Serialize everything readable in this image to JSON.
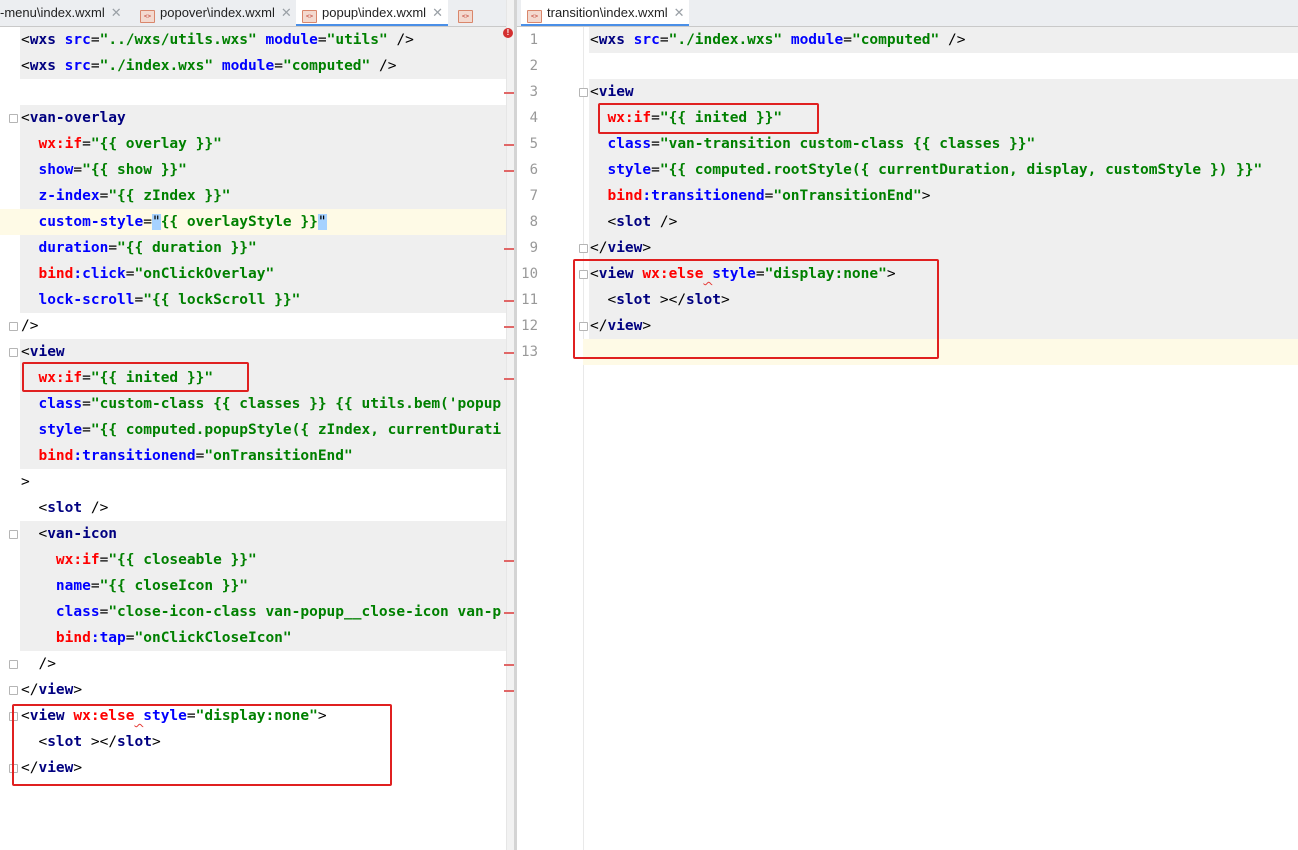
{
  "left_editor": {
    "tabs": [
      {
        "label": "-menu\\index.wxml",
        "active": false
      },
      {
        "label": "popover\\index.wxml",
        "active": false
      },
      {
        "label": "popup\\index.wxml",
        "active": true
      }
    ],
    "lines": [
      {
        "segs": [
          {
            "t": "p",
            "v": "<"
          },
          {
            "t": "t",
            "v": "wxs"
          },
          {
            "t": "p",
            "v": " "
          },
          {
            "t": "a",
            "v": "src"
          },
          {
            "t": "p",
            "v": "="
          },
          {
            "t": "s",
            "v": "\"../wxs/utils.wxs\""
          },
          {
            "t": "p",
            "v": " "
          },
          {
            "t": "a",
            "v": "module"
          },
          {
            "t": "p",
            "v": "="
          },
          {
            "t": "s",
            "v": "\"utils\""
          },
          {
            "t": "p",
            "v": " />"
          }
        ]
      },
      {
        "segs": [
          {
            "t": "p",
            "v": "<"
          },
          {
            "t": "t",
            "v": "wxs"
          },
          {
            "t": "p",
            "v": " "
          },
          {
            "t": "a",
            "v": "src"
          },
          {
            "t": "p",
            "v": "="
          },
          {
            "t": "s",
            "v": "\"./index.wxs\""
          },
          {
            "t": "p",
            "v": " "
          },
          {
            "t": "a",
            "v": "module"
          },
          {
            "t": "p",
            "v": "="
          },
          {
            "t": "s",
            "v": "\"computed\""
          },
          {
            "t": "p",
            "v": " />"
          }
        ]
      },
      {
        "segs": []
      },
      {
        "segs": [
          {
            "t": "p",
            "v": "<"
          },
          {
            "t": "t",
            "v": "van-overlay"
          }
        ]
      },
      {
        "segs": [
          {
            "t": "p",
            "v": "  "
          },
          {
            "t": "ar",
            "v": "wx:if"
          },
          {
            "t": "p",
            "v": "="
          },
          {
            "t": "s",
            "v": "\"{{ overlay }}\""
          }
        ]
      },
      {
        "segs": [
          {
            "t": "p",
            "v": "  "
          },
          {
            "t": "a",
            "v": "show"
          },
          {
            "t": "p",
            "v": "="
          },
          {
            "t": "s",
            "v": "\"{{ show }}\""
          }
        ]
      },
      {
        "segs": [
          {
            "t": "p",
            "v": "  "
          },
          {
            "t": "a",
            "v": "z-index"
          },
          {
            "t": "p",
            "v": "="
          },
          {
            "t": "s",
            "v": "\"{{ zIndex }}\""
          }
        ]
      },
      {
        "segs": [
          {
            "t": "p",
            "v": "  "
          },
          {
            "t": "a",
            "v": "custom-style"
          },
          {
            "t": "p",
            "v": "="
          },
          {
            "t": "sel",
            "v": "\""
          },
          {
            "t": "s",
            "v": "{{ overlayStyle }}"
          },
          {
            "t": "sel",
            "v": "\""
          }
        ]
      },
      {
        "segs": [
          {
            "t": "p",
            "v": "  "
          },
          {
            "t": "a",
            "v": "duration"
          },
          {
            "t": "p",
            "v": "="
          },
          {
            "t": "s",
            "v": "\"{{ duration }}\""
          }
        ]
      },
      {
        "segs": [
          {
            "t": "p",
            "v": "  "
          },
          {
            "t": "ar",
            "v": "bind"
          },
          {
            "t": "a",
            "v": ":click"
          },
          {
            "t": "p",
            "v": "="
          },
          {
            "t": "s",
            "v": "\"onClickOverlay\""
          }
        ]
      },
      {
        "segs": [
          {
            "t": "p",
            "v": "  "
          },
          {
            "t": "a",
            "v": "lock-scroll"
          },
          {
            "t": "p",
            "v": "="
          },
          {
            "t": "s",
            "v": "\"{{ lockScroll }}\""
          }
        ]
      },
      {
        "segs": [
          {
            "t": "p",
            "v": "/>"
          }
        ]
      },
      {
        "segs": [
          {
            "t": "p",
            "v": "<"
          },
          {
            "t": "t",
            "v": "view"
          }
        ]
      },
      {
        "segs": [
          {
            "t": "p",
            "v": "  "
          },
          {
            "t": "ar",
            "v": "wx:if"
          },
          {
            "t": "p",
            "v": "="
          },
          {
            "t": "s",
            "v": "\"{{ inited }}\""
          }
        ]
      },
      {
        "segs": [
          {
            "t": "p",
            "v": "  "
          },
          {
            "t": "a",
            "v": "class"
          },
          {
            "t": "p",
            "v": "="
          },
          {
            "t": "s",
            "v": "\"custom-class {{ classes }} {{ utils.bem('popup"
          }
        ]
      },
      {
        "segs": [
          {
            "t": "p",
            "v": "  "
          },
          {
            "t": "a",
            "v": "style"
          },
          {
            "t": "p",
            "v": "="
          },
          {
            "t": "s",
            "v": "\"{{ computed.popupStyle({ zIndex, currentDurati"
          }
        ]
      },
      {
        "segs": [
          {
            "t": "p",
            "v": "  "
          },
          {
            "t": "ar",
            "v": "bind"
          },
          {
            "t": "a",
            "v": ":transitionend"
          },
          {
            "t": "p",
            "v": "="
          },
          {
            "t": "s",
            "v": "\"onTransitionEnd\""
          }
        ]
      },
      {
        "segs": [
          {
            "t": "p",
            "v": ">"
          }
        ]
      },
      {
        "segs": [
          {
            "t": "p",
            "v": "  <"
          },
          {
            "t": "t",
            "v": "slot"
          },
          {
            "t": "p",
            "v": " />"
          }
        ]
      },
      {
        "segs": [
          {
            "t": "p",
            "v": "  <"
          },
          {
            "t": "t",
            "v": "van-icon"
          }
        ]
      },
      {
        "segs": [
          {
            "t": "p",
            "v": "    "
          },
          {
            "t": "ar",
            "v": "wx:if"
          },
          {
            "t": "p",
            "v": "="
          },
          {
            "t": "s",
            "v": "\"{{ closeable }}\""
          }
        ]
      },
      {
        "segs": [
          {
            "t": "p",
            "v": "    "
          },
          {
            "t": "a",
            "v": "name"
          },
          {
            "t": "p",
            "v": "="
          },
          {
            "t": "s",
            "v": "\"{{ closeIcon }}\""
          }
        ]
      },
      {
        "segs": [
          {
            "t": "p",
            "v": "    "
          },
          {
            "t": "a",
            "v": "class"
          },
          {
            "t": "p",
            "v": "="
          },
          {
            "t": "s",
            "v": "\"close-icon-class van-popup__close-icon van-p"
          }
        ]
      },
      {
        "segs": [
          {
            "t": "p",
            "v": "    "
          },
          {
            "t": "ar",
            "v": "bind"
          },
          {
            "t": "a",
            "v": ":tap"
          },
          {
            "t": "p",
            "v": "="
          },
          {
            "t": "s",
            "v": "\"onClickCloseIcon\""
          }
        ]
      },
      {
        "segs": [
          {
            "t": "p",
            "v": "  />"
          }
        ]
      },
      {
        "segs": [
          {
            "t": "p",
            "v": "</"
          },
          {
            "t": "t",
            "v": "view"
          },
          {
            "t": "p",
            "v": ">"
          }
        ]
      },
      {
        "segs": [
          {
            "t": "p",
            "v": "<"
          },
          {
            "t": "t",
            "v": "view"
          },
          {
            "t": "p",
            "v": " "
          },
          {
            "t": "ar",
            "v": "wx:else"
          },
          {
            "t": "sq",
            "v": " "
          },
          {
            "t": "a",
            "v": "style"
          },
          {
            "t": "p",
            "v": "="
          },
          {
            "t": "s",
            "v": "\"display:none\""
          },
          {
            "t": "p",
            "v": ">"
          }
        ]
      },
      {
        "segs": [
          {
            "t": "p",
            "v": "  <"
          },
          {
            "t": "t",
            "v": "slot"
          },
          {
            "t": "p",
            "v": " ></"
          },
          {
            "t": "t",
            "v": "slot"
          },
          {
            "t": "p",
            "v": ">"
          }
        ]
      },
      {
        "segs": [
          {
            "t": "p",
            "v": "</"
          },
          {
            "t": "t",
            "v": "view"
          },
          {
            "t": "p",
            "v": ">"
          }
        ]
      }
    ]
  },
  "right_editor": {
    "tabs": [
      {
        "label": "transition\\index.wxml",
        "active": true
      }
    ],
    "lines": [
      {
        "n": "1",
        "segs": [
          {
            "t": "p",
            "v": "<"
          },
          {
            "t": "t",
            "v": "wxs"
          },
          {
            "t": "p",
            "v": " "
          },
          {
            "t": "a",
            "v": "src"
          },
          {
            "t": "p",
            "v": "="
          },
          {
            "t": "s",
            "v": "\"./index.wxs\""
          },
          {
            "t": "p",
            "v": " "
          },
          {
            "t": "a",
            "v": "module"
          },
          {
            "t": "p",
            "v": "="
          },
          {
            "t": "s",
            "v": "\"computed\""
          },
          {
            "t": "p",
            "v": " />"
          }
        ]
      },
      {
        "n": "2",
        "segs": []
      },
      {
        "n": "3",
        "segs": [
          {
            "t": "p",
            "v": "<"
          },
          {
            "t": "t",
            "v": "view"
          }
        ]
      },
      {
        "n": "4",
        "segs": [
          {
            "t": "p",
            "v": "  "
          },
          {
            "t": "ar",
            "v": "wx:if"
          },
          {
            "t": "p",
            "v": "="
          },
          {
            "t": "s",
            "v": "\"{{ inited }}\""
          }
        ]
      },
      {
        "n": "5",
        "segs": [
          {
            "t": "p",
            "v": "  "
          },
          {
            "t": "a",
            "v": "class"
          },
          {
            "t": "p",
            "v": "="
          },
          {
            "t": "s",
            "v": "\"van-transition custom-class {{ classes }}\""
          }
        ]
      },
      {
        "n": "6",
        "segs": [
          {
            "t": "p",
            "v": "  "
          },
          {
            "t": "a",
            "v": "style"
          },
          {
            "t": "p",
            "v": "="
          },
          {
            "t": "s",
            "v": "\"{{ computed.rootStyle({ currentDuration, display, customStyle }) }}\""
          }
        ]
      },
      {
        "n": "7",
        "segs": [
          {
            "t": "p",
            "v": "  "
          },
          {
            "t": "ar",
            "v": "bind"
          },
          {
            "t": "a",
            "v": ":transitionend"
          },
          {
            "t": "p",
            "v": "="
          },
          {
            "t": "s",
            "v": "\"onTransitionEnd\""
          },
          {
            "t": "p",
            "v": ">"
          }
        ]
      },
      {
        "n": "8",
        "segs": [
          {
            "t": "p",
            "v": "  <"
          },
          {
            "t": "t",
            "v": "slot"
          },
          {
            "t": "p",
            "v": " />"
          }
        ]
      },
      {
        "n": "9",
        "segs": [
          {
            "t": "p",
            "v": "</"
          },
          {
            "t": "t",
            "v": "view"
          },
          {
            "t": "p",
            "v": ">"
          }
        ]
      },
      {
        "n": "10",
        "segs": [
          {
            "t": "p",
            "v": "<"
          },
          {
            "t": "t",
            "v": "view"
          },
          {
            "t": "p",
            "v": " "
          },
          {
            "t": "ar",
            "v": "wx:else"
          },
          {
            "t": "sq",
            "v": " "
          },
          {
            "t": "a",
            "v": "style"
          },
          {
            "t": "p",
            "v": "="
          },
          {
            "t": "s",
            "v": "\"display:none\""
          },
          {
            "t": "p",
            "v": ">"
          }
        ]
      },
      {
        "n": "11",
        "segs": [
          {
            "t": "p",
            "v": "  <"
          },
          {
            "t": "t",
            "v": "slot"
          },
          {
            "t": "p",
            "v": " ></"
          },
          {
            "t": "t",
            "v": "slot"
          },
          {
            "t": "p",
            "v": ">"
          }
        ]
      },
      {
        "n": "12",
        "segs": [
          {
            "t": "p",
            "v": "</"
          },
          {
            "t": "t",
            "v": "view"
          },
          {
            "t": "p",
            "v": ">"
          }
        ]
      },
      {
        "n": "13",
        "segs": []
      }
    ]
  },
  "colors": {
    "tag": "#000080",
    "attribute": "#0000ff",
    "directive": "#ff0000",
    "string": "#008000",
    "highlight_box": "#e02020"
  }
}
